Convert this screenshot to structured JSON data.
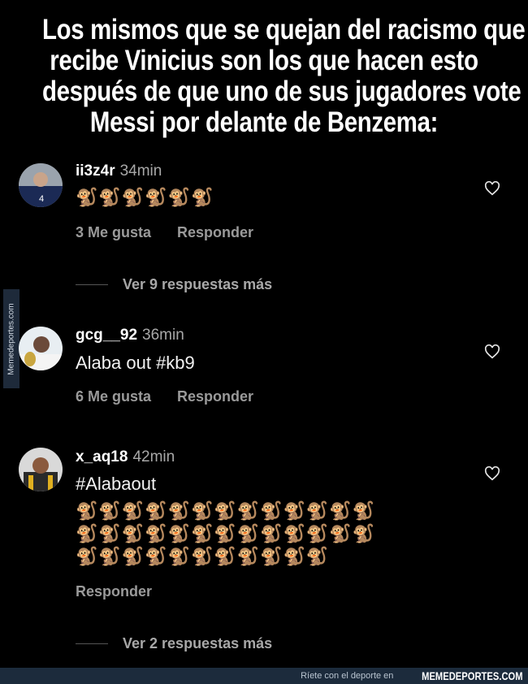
{
  "headline": {
    "line1": "Los mismos que se quejan del racismo que",
    "line2": "recibe Vinicius son los que hacen esto",
    "line3": "después de que uno de sus jugadores vote a",
    "line4": "Messi por delante de Benzema:"
  },
  "watermark_side": "Memedeportes.com",
  "comments": [
    {
      "username": "ii3z4r",
      "time": "34min",
      "body": "🐒🐒🐒🐒🐒🐒",
      "likes": "3 Me gusta",
      "reply": "Responder",
      "more_replies": "Ver 9 respuestas más"
    },
    {
      "username": "gcg__92",
      "time": "36min",
      "body": "Alaba out #kb9",
      "likes": "6 Me gusta",
      "reply": "Responder"
    },
    {
      "username": "x_aq18",
      "time": "42min",
      "body": "#Alabaout",
      "emoji_rows": [
        "🐒🐒🐒🐒🐒🐒🐒🐒🐒🐒🐒🐒🐒",
        "🐒🐒🐒🐒🐒🐒🐒🐒🐒🐒🐒🐒🐒",
        "🐒🐒🐒🐒🐒🐒🐒🐒🐒🐒🐒"
      ],
      "reply": "Responder",
      "more_replies": "Ver 2 respuestas más"
    }
  ],
  "icons": {
    "like": "heart-outline-icon"
  },
  "footer": {
    "small": "Ríete con el deporte en",
    "brand": "MEMEDEPORTES.COM"
  }
}
